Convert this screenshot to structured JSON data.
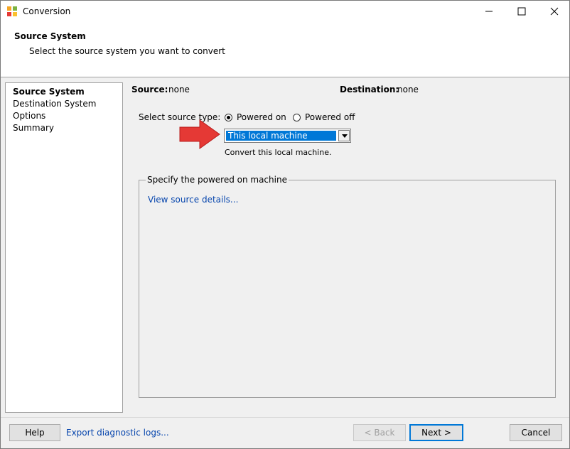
{
  "window": {
    "title": "Conversion",
    "minimize_icon": "minimize-icon",
    "maximize_icon": "maximize-icon",
    "close_icon": "close-icon"
  },
  "header": {
    "title": "Source System",
    "subtitle": "Select the source system you want to convert"
  },
  "steps": [
    {
      "label": "Source System",
      "active": true
    },
    {
      "label": "Destination System",
      "active": false
    },
    {
      "label": "Options",
      "active": false
    },
    {
      "label": "Summary",
      "active": false
    }
  ],
  "summary": {
    "source_label": "Source:",
    "source_value": "none",
    "destination_label": "Destination:",
    "destination_value": "none"
  },
  "source_type": {
    "label": "Select source type:",
    "options": [
      "Powered on",
      "Powered off"
    ],
    "selected": "Powered on"
  },
  "machine_select": {
    "value": "This local machine",
    "description": "Convert this local machine."
  },
  "group": {
    "legend": "Specify the powered on machine",
    "details_link": "View source details..."
  },
  "footer": {
    "help": "Help",
    "export_logs": "Export diagnostic logs...",
    "back": "< Back",
    "next": "Next >",
    "cancel": "Cancel"
  },
  "colors": {
    "arrow": "#e53935",
    "selection": "#0078d7",
    "link": "#0645ad"
  }
}
